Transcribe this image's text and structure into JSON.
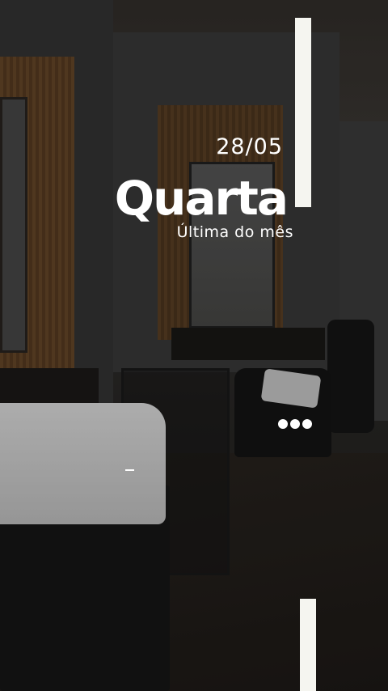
{
  "story": {
    "date": "28/05",
    "title": "Quarta",
    "subtitle": "Última do mês"
  },
  "colors": {
    "overlay_text": "#ffffff",
    "bar": "#f5f5f0"
  },
  "icons": {
    "more": "more-dots-icon"
  }
}
